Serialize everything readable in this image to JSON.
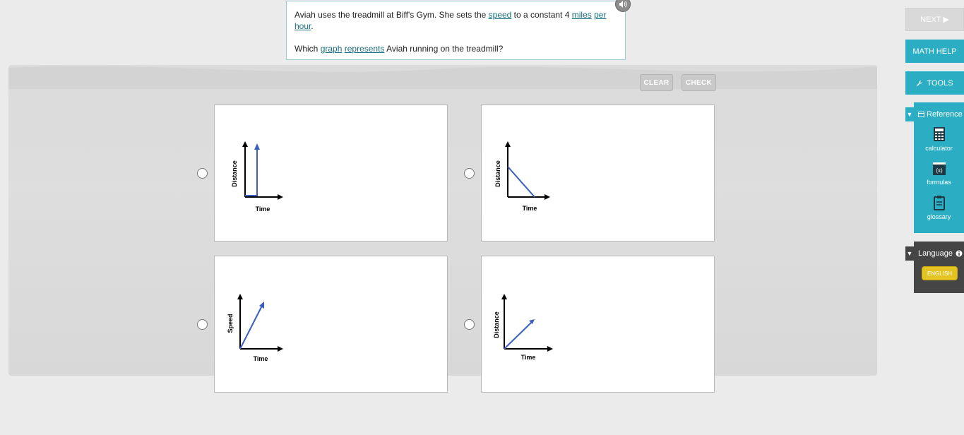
{
  "question": {
    "parts": {
      "p1": "Aviah uses the treadmill at Biff's Gym. She sets the ",
      "speed": "speed",
      "p2": " to a constant 4 ",
      "miles": "miles",
      "per": "per",
      "hour": "hour",
      "p3": "."
    },
    "line2": {
      "which": "Which ",
      "graph": "graph",
      "represents": "represents",
      "rest": " Aviah running on the treadmill?"
    }
  },
  "actions": {
    "clear": "CLEAR",
    "check": "CHECK"
  },
  "options": [
    {
      "ylabel": "Distance",
      "xlabel": "Time"
    },
    {
      "ylabel": "Distance",
      "xlabel": "Time"
    },
    {
      "ylabel": "Speed",
      "xlabel": "Time"
    },
    {
      "ylabel": "Distance",
      "xlabel": "Time"
    }
  ],
  "sidebar": {
    "next": "NEXT ▶",
    "math_help": "MATH HELP",
    "tools": "TOOLS",
    "reference": {
      "title": "Reference",
      "items": [
        "calculator",
        "formulas",
        "glossary"
      ]
    },
    "language": {
      "title": "Language",
      "selected": "ENGLISH"
    }
  },
  "colors": {
    "accent": "#2baec4",
    "graph_line": "#3a5fbf",
    "language_button": "#e3c322"
  }
}
